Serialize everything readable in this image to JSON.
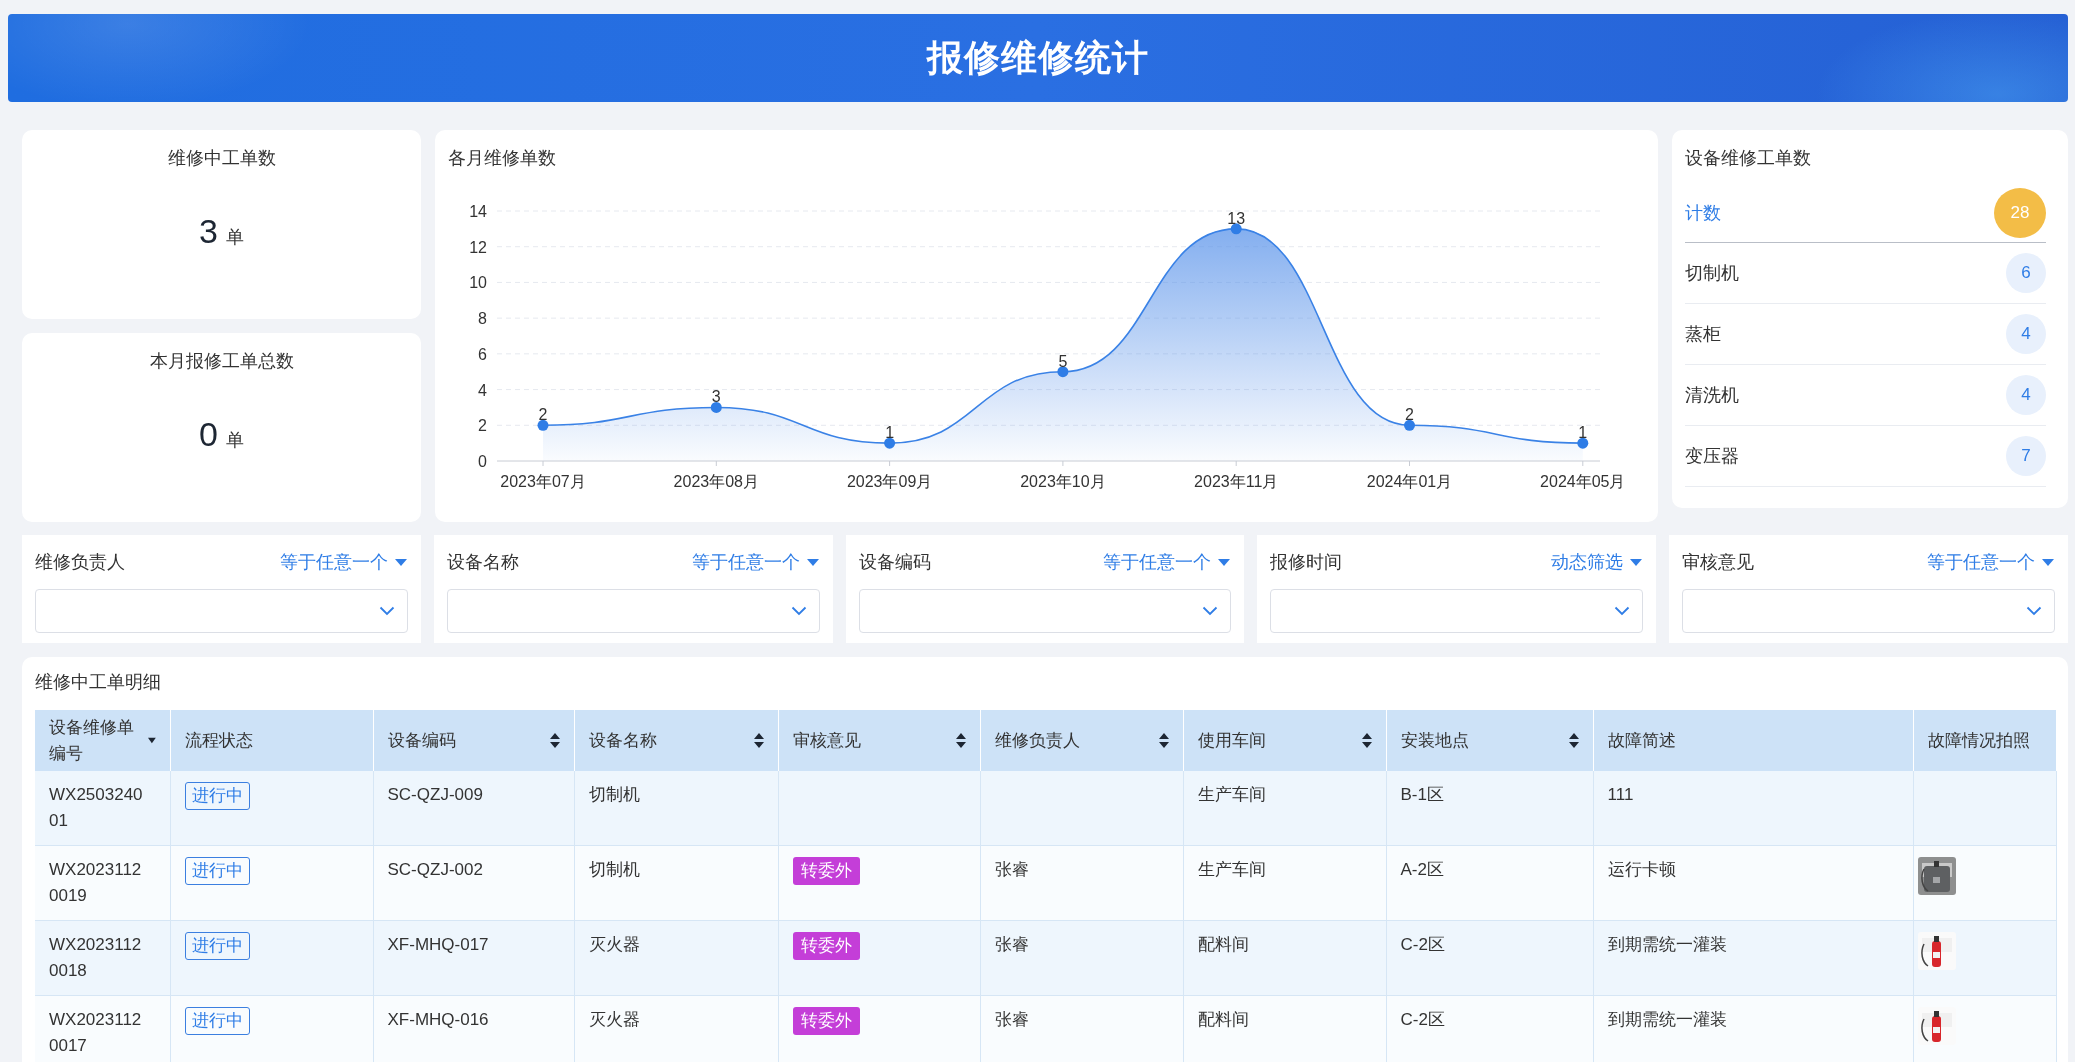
{
  "header": {
    "title": "报修维修统计"
  },
  "stats": [
    {
      "label": "维修中工单数",
      "value": "3",
      "unit": "单"
    },
    {
      "label": "本月报修工单总数",
      "value": "0",
      "unit": "单"
    }
  ],
  "monthly_chart": {
    "chart_data": {
      "type": "area",
      "title": "各月维修单数",
      "categories": [
        "2023年07月",
        "2023年08月",
        "2023年09月",
        "2023年10月",
        "2023年11月",
        "2024年01月",
        "2024年05月"
      ],
      "values": [
        2,
        3,
        1,
        5,
        13,
        2,
        1
      ],
      "ylim": [
        0,
        14
      ],
      "yticks": [
        0,
        2,
        4,
        6,
        8,
        10,
        12,
        14
      ],
      "data_labels": true,
      "grid": true
    }
  },
  "equipment_counts": {
    "title": "设备维修工单数",
    "items": [
      {
        "name": "计数",
        "count": "28",
        "kind": "total"
      },
      {
        "name": "切制机",
        "count": "6",
        "kind": "item"
      },
      {
        "name": "蒸柜",
        "count": "4",
        "kind": "item"
      },
      {
        "name": "清洗机",
        "count": "4",
        "kind": "item"
      },
      {
        "name": "变压器",
        "count": "7",
        "kind": "item"
      }
    ]
  },
  "filters": [
    {
      "label": "维修负责人",
      "operator": "等于任意一个"
    },
    {
      "label": "设备名称",
      "operator": "等于任意一个"
    },
    {
      "label": "设备编码",
      "operator": "等于任意一个"
    },
    {
      "label": "报修时间",
      "operator": "动态筛选"
    },
    {
      "label": "审核意见",
      "operator": "等于任意一个"
    }
  ],
  "detail_table": {
    "title": "维修中工单明细",
    "columns": [
      {
        "label": "设备维修单编号",
        "sortable": true,
        "sorted": true
      },
      {
        "label": "流程状态",
        "sortable": false
      },
      {
        "label": "设备编码",
        "sortable": true
      },
      {
        "label": "设备名称",
        "sortable": true
      },
      {
        "label": "审核意见",
        "sortable": true
      },
      {
        "label": "维修负责人",
        "sortable": true
      },
      {
        "label": "使用车间",
        "sortable": true
      },
      {
        "label": "安装地点",
        "sortable": true
      },
      {
        "label": "故障简述",
        "sortable": false
      },
      {
        "label": "故障情况拍照",
        "sortable": false
      }
    ],
    "rows": [
      {
        "id": "WX250324001",
        "status": "进行中",
        "code": "SC-QZJ-009",
        "name": "切制机",
        "workshop": "生产车间",
        "location": "B-1区",
        "fault": "111",
        "photo": false
      },
      {
        "id": "WX20231120019",
        "status": "进行中",
        "code": "SC-QZJ-002",
        "name": "切制机",
        "review": "转委外",
        "owner": "张睿",
        "workshop": "生产车间",
        "location": "A-2区",
        "fault": "运行卡顿",
        "photo": true
      },
      {
        "id": "WX20231120018",
        "status": "进行中",
        "code": "XF-MHQ-017",
        "name": "灭火器",
        "review": "转委外",
        "owner": "张睿",
        "workshop": "配料间",
        "location": "C-2区",
        "fault": "到期需统一灌装",
        "photo": true
      },
      {
        "id": "WX20231120017",
        "status": "进行中",
        "code": "XF-MHQ-016",
        "name": "灭火器",
        "review": "转委外",
        "owner": "张睿",
        "workshop": "配料间",
        "location": "C-2区",
        "fault": "到期需统一灌装",
        "photo": true
      }
    ]
  }
}
